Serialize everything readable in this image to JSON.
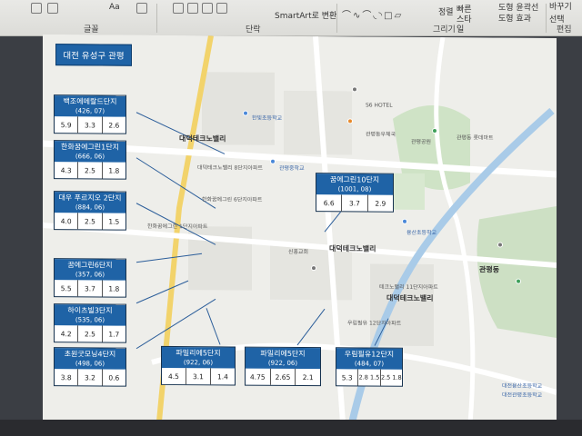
{
  "ribbon": {
    "groups": {
      "font": "글꼴",
      "paragraph": "단락",
      "drawing": "그리기",
      "editing": "편집"
    },
    "smartart": "SmartArt로 변환",
    "arrange": "정렬",
    "quick_styles": "빠른 스타일",
    "shape_outline": "도형 윤곽선",
    "shape_effects": "도형 효과",
    "select": "선택",
    "replace": "바꾸기"
  },
  "slide": {
    "title": "대전 유성구 관평",
    "cards": [
      {
        "name": "백조에메랄드단지",
        "sub": "(426, 07)",
        "values": [
          "5.9",
          "3.3",
          "2.6"
        ]
      },
      {
        "name": "한화꿈에그린1단지",
        "sub": "(666, 06)",
        "values": [
          "4.3",
          "2.5",
          "1.8"
        ]
      },
      {
        "name": "대우 푸르지오 2단지",
        "sub": "(884, 06)",
        "values": [
          "4.0",
          "2.5",
          "1.5"
        ]
      },
      {
        "name": "꿈에그린6단지",
        "sub": "(357, 06)",
        "values": [
          "5.5",
          "3.7",
          "1.8"
        ]
      },
      {
        "name": "하이츠빌3단지",
        "sub": "(535, 06)",
        "values": [
          "4.2",
          "2.5",
          "1.7"
        ]
      },
      {
        "name": "초원굿모닝4단지",
        "sub": "(498, 06)",
        "values": [
          "3.8",
          "3.2",
          "0.6"
        ]
      },
      {
        "name": "꿈에그린10단지",
        "sub": "(1001, 08)",
        "values": [
          "6.6",
          "3.7",
          "2.9"
        ]
      },
      {
        "name": "파밀리에5단지",
        "sub": "(922, 06)",
        "values": [
          "4.5",
          "3.1",
          "1.4"
        ]
      },
      {
        "name": "파밀리에5단지",
        "sub": "(922, 06)",
        "values": [
          "4.75",
          "2.65",
          "2.1"
        ]
      },
      {
        "name": "우림필유12단지",
        "sub": "(484, 07)",
        "values": [
          "5.3",
          "2.8 1.5",
          "2.5 1.8"
        ]
      }
    ],
    "map_labels": {
      "district1": "대덕테크노밸리",
      "district2": "대덕테크노밸리",
      "district3": "대덕테크노밸리",
      "gwanpyeong": "관평동",
      "school1": "한빛초등학교",
      "school2": "관평중학교",
      "school3": "용산초등학교",
      "apt1": "한화꿈에그린 1단지아파트",
      "apt2": "대덕테크노밸리 8단지아파트",
      "apt3": "한화꿈에그린 6단지아파트",
      "apt4": "테크노밸리 11단지아파트",
      "apt5": "우림필유 12단지아파트",
      "church": "신흥교회",
      "hotel": "S6 HOTEL",
      "bank": "관평동우체국",
      "park": "관평공원",
      "mall": "관평동 롯데마트",
      "bottom1": "대전용산초등학교",
      "bottom2": "대전관평초등학교"
    }
  }
}
